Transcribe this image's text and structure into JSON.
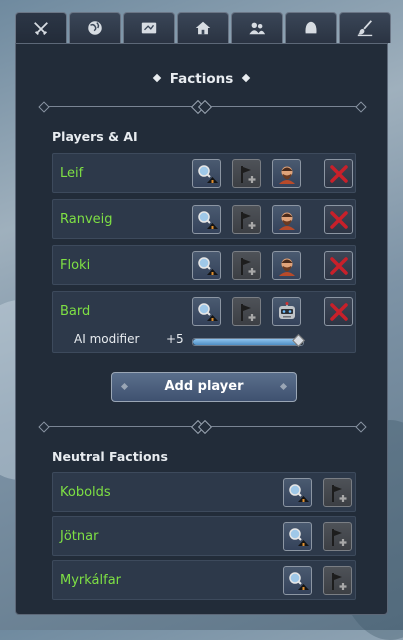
{
  "tabs": [
    {
      "icon": "crossed-swords-icon",
      "active": true
    },
    {
      "icon": "globe-icon",
      "active": false
    },
    {
      "icon": "map-icon",
      "active": false
    },
    {
      "icon": "house-icon",
      "active": false
    },
    {
      "icon": "people-icon",
      "active": false
    },
    {
      "icon": "helmet-icon",
      "active": false
    },
    {
      "icon": "brush-icon",
      "active": false
    }
  ],
  "header": {
    "title": "Factions"
  },
  "players_section": {
    "title": "Players & AI",
    "players": [
      {
        "name": "Leif",
        "controller": "human-portrait-icon"
      },
      {
        "name": "Ranveig",
        "controller": "human-portrait-icon"
      },
      {
        "name": "Floki",
        "controller": "human-portrait-icon"
      },
      {
        "name": "Bard",
        "controller": "robot-icon"
      }
    ],
    "ai_modifier_label": "AI modifier",
    "ai_modifier_value": "+5",
    "ai_modifier_fraction": 0.95,
    "add_player_label": "Add player"
  },
  "neutral_section": {
    "title": "Neutral Factions",
    "factions": [
      {
        "name": "Kobolds"
      },
      {
        "name": "Jötnar"
      },
      {
        "name": "Myrkálfar"
      }
    ]
  },
  "colors": {
    "player_name": "#7ee044",
    "remove_red": "#c8202a",
    "panel_bg": "#222c39"
  }
}
